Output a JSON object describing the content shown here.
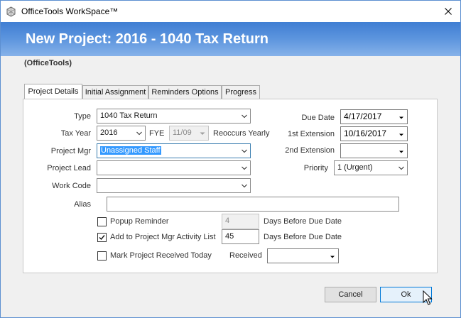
{
  "window": {
    "title": "OfficeTools WorkSpace™",
    "banner_title": "New Project: 2016 - 1040 Tax Return",
    "subtitle": "(OfficeTools)"
  },
  "tabs": [
    {
      "label": "Project Details",
      "active": true
    },
    {
      "label": "Initial Assignment",
      "active": false
    },
    {
      "label": "Reminders Options",
      "active": false
    },
    {
      "label": "Progress",
      "active": false
    }
  ],
  "form": {
    "type_label": "Type",
    "type_value": "1040 Tax Return",
    "tax_year_label": "Tax Year",
    "tax_year_value": "2016",
    "fye_label": "FYE",
    "fye_value": "11/09",
    "reoccurs_label": "Reoccurs Yearly",
    "project_mgr_label": "Project Mgr",
    "project_mgr_value": "Unassigned Staff",
    "project_lead_label": "Project Lead",
    "project_lead_value": "",
    "work_code_label": "Work Code",
    "work_code_value": "",
    "alias_label": "Alias",
    "alias_value": "",
    "due_date_label": "Due Date",
    "due_date_value": "4/17/2017",
    "first_ext_label": "1st Extension",
    "first_ext_value": "10/16/2017",
    "second_ext_label": "2nd Extension",
    "second_ext_value": "",
    "priority_label": "Priority",
    "priority_value": "1 (Urgent)",
    "popup_reminder_label": "Popup Reminder",
    "popup_reminder_checked": false,
    "popup_days_value": "4",
    "popup_days_suffix": "Days Before Due Date",
    "add_activity_label": "Add to Project Mgr Activity List",
    "add_activity_checked": true,
    "activity_days_value": "45",
    "activity_days_suffix": "Days Before Due Date",
    "mark_received_label": "Mark Project Received Today",
    "mark_received_checked": false,
    "received_label": "Received",
    "received_value": ""
  },
  "buttons": {
    "cancel_label": "Cancel",
    "ok_label": "Ok"
  },
  "icons": {
    "app": "officetools-app-icon",
    "close": "close-icon",
    "dropdown": "chevron-down-icon",
    "check": "checkmark-icon",
    "cursor": "mouse-pointer-icon"
  }
}
